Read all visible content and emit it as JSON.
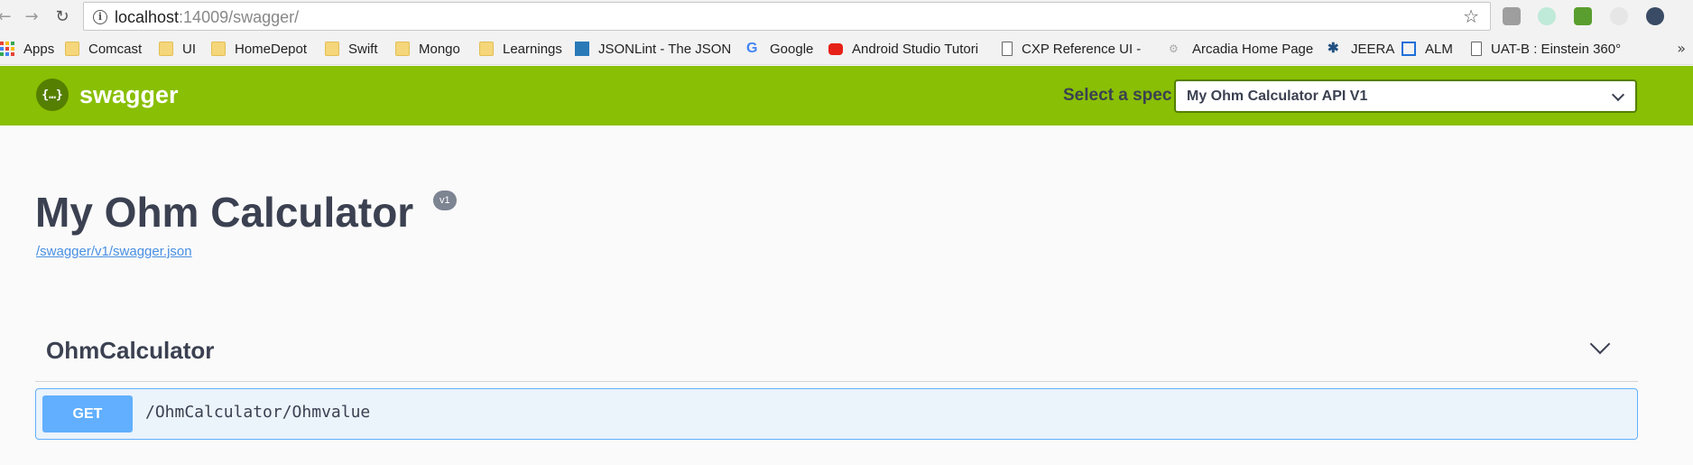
{
  "browser": {
    "back_icon": "arrow-left-icon",
    "forward_icon": "arrow-right-icon",
    "reload_icon": "reload-icon",
    "url_host": "localhost",
    "url_rest": ":14009/swagger/",
    "bookmark_star_icon": "star-icon"
  },
  "bookmarks": [
    {
      "label": "Apps",
      "icon": "apps-icon"
    },
    {
      "label": "Comcast",
      "icon": "folder-icon"
    },
    {
      "label": "UI",
      "icon": "folder-icon"
    },
    {
      "label": "HomeDepot",
      "icon": "folder-icon"
    },
    {
      "label": "Swift",
      "icon": "folder-icon"
    },
    {
      "label": "Mongo",
      "icon": "folder-icon"
    },
    {
      "label": "Learnings",
      "icon": "folder-icon"
    },
    {
      "label": "JSONLint - The JSON",
      "icon": "json-icon"
    },
    {
      "label": "Google",
      "icon": "google-icon"
    },
    {
      "label": "Android Studio Tutori",
      "icon": "youtube-icon"
    },
    {
      "label": "CXP Reference UI - Pl",
      "icon": "page-icon"
    },
    {
      "label": "Arcadia Home Page",
      "icon": "gear-icon"
    },
    {
      "label": "JEERA",
      "icon": "jira-icon"
    },
    {
      "label": "ALM",
      "icon": "alm-icon"
    },
    {
      "label": "UAT-B : Einstein 360°",
      "icon": "page-icon"
    }
  ],
  "swagger": {
    "logo_text": "swagger",
    "select_spec_label": "Select a spec",
    "selected_spec": "My Ohm Calculator API V1",
    "accent_color": "#89bf04"
  },
  "info": {
    "title": "My Ohm Calculator",
    "version": "v1",
    "spec_url": "/swagger/v1/swagger.json"
  },
  "operations": {
    "tag": "OhmCalculator",
    "items": [
      {
        "method": "GET",
        "path": "/OhmCalculator/Ohmvalue",
        "color": "#61affe"
      }
    ]
  }
}
